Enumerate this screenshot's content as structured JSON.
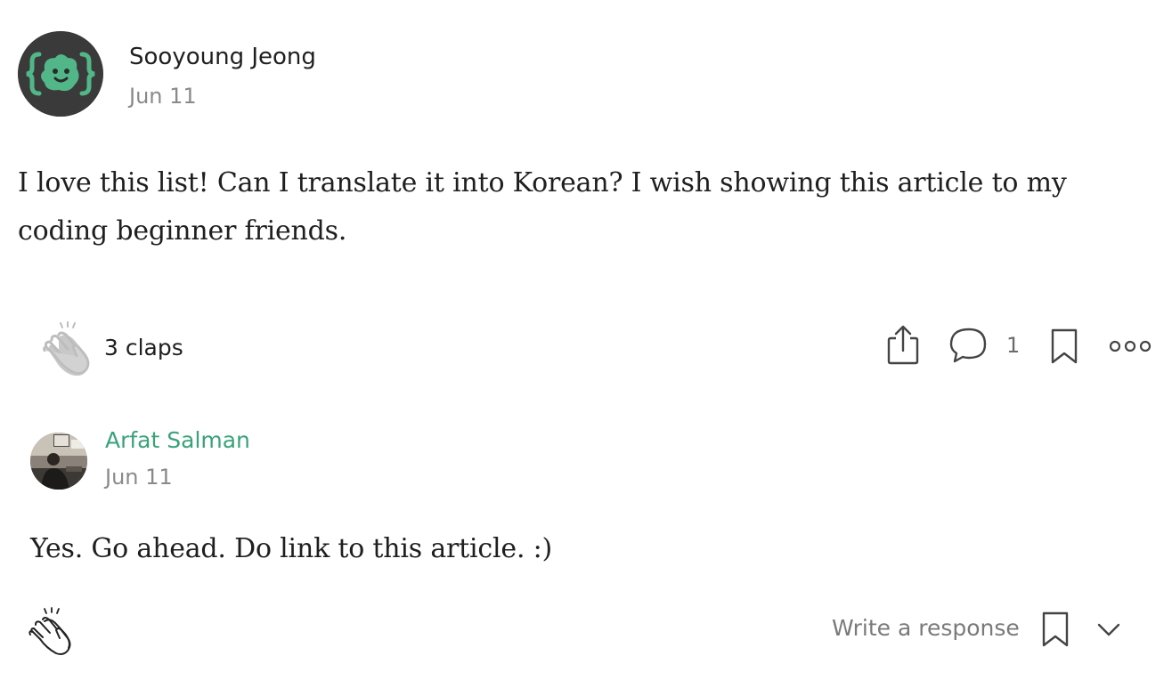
{
  "response": {
    "author": "Sooyoung Jeong",
    "date": "Jun 11",
    "body": "I love this list! Can I translate it into Korean? I wish showing this article to my coding beginner friends.",
    "claps_label": "3 claps",
    "comment_count": "1"
  },
  "reply": {
    "author": "Arfat Salman",
    "date": "Jun 11",
    "body": "Yes. Go ahead. Do link to this article. :)",
    "write_response": "Write a response"
  },
  "icons": {
    "main_avatar": "logo-avatar-icon",
    "clap": "clap-icon",
    "share": "share-icon",
    "comment": "comment-icon",
    "bookmark": "bookmark-icon",
    "more": "more-options-icon",
    "chevron": "chevron-down-icon"
  },
  "colors": {
    "author_link": "#3aa27a",
    "avatar_logo_green": "#52b788",
    "muted_text": "#8a8a8a",
    "icon_gray": "#6b6b6b",
    "clapped_gray": "#bdbdbd"
  }
}
